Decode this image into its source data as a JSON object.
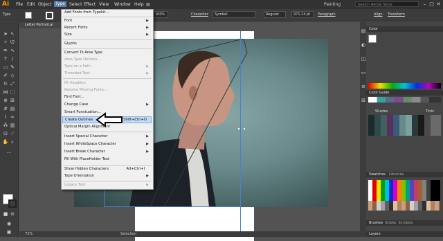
{
  "app": {
    "logo": "Ai",
    "workspace": "Painting",
    "search_placeholder": "Search Adobe Stock"
  },
  "menubar": [
    "File",
    "Edit",
    "Object",
    "Type",
    "Select",
    "Effect",
    "View",
    "Window",
    "Help"
  ],
  "control": {
    "label_type": "Type",
    "zoom": "100%",
    "character_label": "Character",
    "font_name": "Symbol",
    "font_style": "Regular",
    "font_size": "971.24 pt",
    "paragraph_label": "Paragraph",
    "align_label": "Align",
    "transform_label": "Transform"
  },
  "document": {
    "tab": "Letter Portrait.ai",
    "zoom_status": "72%",
    "status_tool": "Selection"
  },
  "type_menu": {
    "items": [
      {
        "label": "Add Fonts from Typekit...",
        "enabled": true
      },
      {
        "label": "Font",
        "submenu": true,
        "enabled": true
      },
      {
        "label": "Recent Fonts",
        "submenu": true,
        "enabled": true
      },
      {
        "label": "Size",
        "submenu": true,
        "enabled": true
      },
      {
        "label": "Glyphs",
        "enabled": true
      },
      {
        "label": "Convert To Area Type",
        "enabled": true
      },
      {
        "label": "Area Type Options...",
        "enabled": false
      },
      {
        "label": "Type on a Path",
        "submenu": true,
        "enabled": false
      },
      {
        "label": "Threaded Text",
        "submenu": true,
        "enabled": false
      },
      {
        "label": "Fit Headline",
        "enabled": false
      },
      {
        "label": "Resolve Missing Fonts...",
        "enabled": false
      },
      {
        "label": "Find Font...",
        "enabled": true
      },
      {
        "label": "Change Case",
        "submenu": true,
        "enabled": true
      },
      {
        "label": "Smart Punctuation...",
        "enabled": true
      },
      {
        "label": "Create Outlines",
        "shortcut": "Shift+Ctrl+O",
        "enabled": true,
        "highlighted": true
      },
      {
        "label": "Optical Margin Alignment",
        "enabled": true
      },
      {
        "label": "Insert Special Character",
        "submenu": true,
        "enabled": true
      },
      {
        "label": "Insert WhiteSpace Character",
        "submenu": true,
        "enabled": true
      },
      {
        "label": "Insert Break Character",
        "submenu": true,
        "enabled": true
      },
      {
        "label": "Fill With PlaceHolder Text",
        "enabled": true
      },
      {
        "label": "Show Hidden Characters",
        "shortcut": "Alt+Ctrl+I",
        "enabled": true
      },
      {
        "label": "Type Orientation",
        "submenu": true,
        "enabled": true
      },
      {
        "label": "Legacy Text",
        "submenu": true,
        "enabled": false
      }
    ]
  },
  "panels": {
    "color": "Color",
    "color_guide": "Color Guide",
    "shades": "Shades",
    "tints": "Tints",
    "swatches": "Swatches",
    "libraries": "Libraries",
    "brushes": "Brushes",
    "stroke": "Stroke",
    "symbols": "Symbols",
    "layers": "Layers"
  },
  "colors": {
    "accent": "#5a7fb5",
    "highlight": "#c3daf3",
    "logo": "#ff9a00"
  }
}
